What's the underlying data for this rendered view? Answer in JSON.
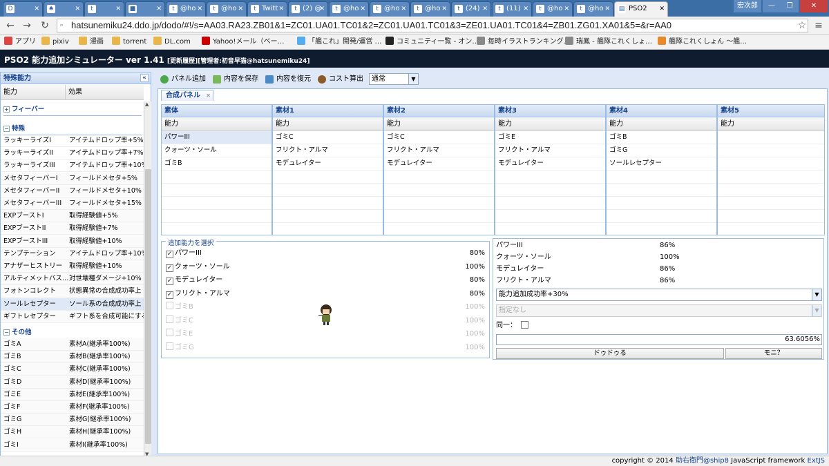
{
  "browser": {
    "tabs": [
      {
        "icon": "D",
        "label": ""
      },
      {
        "icon": "♠",
        "label": ""
      },
      {
        "icon": "t",
        "label": ""
      },
      {
        "icon": "■",
        "label": ""
      },
      {
        "icon": "t",
        "label": "@ho"
      },
      {
        "icon": "t",
        "label": "@ho"
      },
      {
        "icon": "t",
        "label": "Twitt"
      },
      {
        "icon": "t",
        "label": "(2) @"
      },
      {
        "icon": "t",
        "label": "@ho"
      },
      {
        "icon": "t",
        "label": "@ho"
      },
      {
        "icon": "t",
        "label": "@ho"
      },
      {
        "icon": "t",
        "label": "(24)"
      },
      {
        "icon": "t",
        "label": "(11)"
      },
      {
        "icon": "t",
        "label": "@ho"
      },
      {
        "icon": "t",
        "label": "@ho"
      },
      {
        "icon": "▤",
        "label": "PSO2"
      }
    ],
    "user_name": "宏次郎",
    "url": "hatsunemiku24.ddo.jp/dodo/#!/s=AA03.RA23.ZB01&1=ZC01.UA01.TC01&2=ZC01.UA01.TC01&3=ZE01.UA01.TC01&4=ZB01.ZG01.XA01&5=&r=AA0",
    "bookmarks": [
      {
        "label": "アプリ",
        "color": "#d44"
      },
      {
        "label": "pixiv",
        "color": "#e8b64a"
      },
      {
        "label": "漫画",
        "color": "#e8b64a"
      },
      {
        "label": "torrent",
        "color": "#e8b64a"
      },
      {
        "label": "DL.com",
        "color": "#e8b64a"
      },
      {
        "label": "Yahoo!メール（ベー…",
        "color": "#c00"
      },
      {
        "label": "「艦これ」開発/運営 …",
        "color": "#55acee"
      },
      {
        "label": "コミュニティ一覧 - オン…",
        "color": "#222"
      },
      {
        "label": "毎時イラストランキング…",
        "color": "#888"
      },
      {
        "label": "瑞鳳 - 艦隊これくしょ…",
        "color": "#888"
      },
      {
        "label": "艦隊これくしょん 〜艦…",
        "color": "#e88a2a"
      }
    ]
  },
  "app": {
    "title": "PSO2 能力追加シミュレーター ver 1.41",
    "subtitle": "[更新履歴][管理者:初音早猫@hatsunemiku24]"
  },
  "sidebar": {
    "title": "特殊能力",
    "col_ability": "能力",
    "col_effect": "効果",
    "groups": {
      "fever": "フィーバー",
      "special": "特殊",
      "other": "その他"
    },
    "special_items": [
      {
        "name": "ラッキーライズI",
        "effect": "アイテムドロップ率+5%"
      },
      {
        "name": "ラッキーライズII",
        "effect": "アイテムドロップ率+7%"
      },
      {
        "name": "ラッキーライズIII",
        "effect": "アイテムドロップ率+10%"
      },
      {
        "name": "メセタフィーバーI",
        "effect": "フィールドメセタ+5%"
      },
      {
        "name": "メセタフィーバーII",
        "effect": "フィールドメセタ+10%"
      },
      {
        "name": "メセタフィーバーIII",
        "effect": "フィールドメセタ+15%"
      },
      {
        "name": "EXPブーストI",
        "effect": "取得経験値+5%"
      },
      {
        "name": "EXPブーストII",
        "effect": "取得経験値+7%"
      },
      {
        "name": "EXPブーストIII",
        "effect": "取得経験値+10%"
      },
      {
        "name": "テンプテーション",
        "effect": "アイテムドロップ率+10%"
      },
      {
        "name": "アナザーヒストリー",
        "effect": "取得経験値+10%"
      },
      {
        "name": "アルティメットバス…",
        "effect": "対世壊種ダメージ+10%"
      },
      {
        "name": "フォトンコレクト",
        "effect": "状態異常の合成成功率上"
      },
      {
        "name": "ソールレセプター",
        "effect": "ソール系の合成成功率上"
      },
      {
        "name": "ギフトレセプター",
        "effect": "ギフト系を合成可能にする"
      }
    ],
    "other_items": [
      {
        "name": "ゴミA",
        "effect": "素材A(継承率100%)"
      },
      {
        "name": "ゴミB",
        "effect": "素材B(継承率100%)"
      },
      {
        "name": "ゴミC",
        "effect": "素材C(継承率100%)"
      },
      {
        "name": "ゴミD",
        "effect": "素材D(継承率100%)"
      },
      {
        "name": "ゴミE",
        "effect": "素材E(継承率100%)"
      },
      {
        "name": "ゴミF",
        "effect": "素材F(継承率100%)"
      },
      {
        "name": "ゴミG",
        "effect": "素材G(継承率100%)"
      },
      {
        "name": "ゴミH",
        "effect": "素材H(継承率100%)"
      },
      {
        "name": "ゴミI",
        "effect": "素材I(継承率100%)"
      }
    ]
  },
  "toolbar": {
    "add_panel": "パネル追加",
    "save": "内容を保存",
    "restore": "内容を復元",
    "cost": "コスト算出",
    "mode": "通常"
  },
  "panel": {
    "tab_label": "合成パネル",
    "ability_header": "能力",
    "columns": [
      {
        "title": "素体",
        "rows": [
          "パワーIII",
          "クォーツ・ソール",
          "ゴミB"
        ]
      },
      {
        "title": "素材1",
        "rows": [
          "ゴミC",
          "フリクト・アルマ",
          "モデュレイター"
        ]
      },
      {
        "title": "素材2",
        "rows": [
          "ゴミC",
          "フリクト・アルマ",
          "モデュレイター"
        ]
      },
      {
        "title": "素材3",
        "rows": [
          "ゴミE",
          "フリクト・アルマ",
          "モデュレイター"
        ]
      },
      {
        "title": "素材4",
        "rows": [
          "ゴミB",
          "ゴミG",
          "ソールレセプター"
        ]
      },
      {
        "title": "素材5",
        "rows": []
      }
    ],
    "select_legend": "追加能力を選択",
    "choices": [
      {
        "label": "パワーIII",
        "pct": "80%",
        "checked": true,
        "disabled": false
      },
      {
        "label": "クォーツ・ソール",
        "pct": "100%",
        "checked": true,
        "disabled": false
      },
      {
        "label": "モデュレイター",
        "pct": "80%",
        "checked": true,
        "disabled": false
      },
      {
        "label": "フリクト・アルマ",
        "pct": "80%",
        "checked": true,
        "disabled": false
      },
      {
        "label": "ゴミB",
        "pct": "100%",
        "checked": false,
        "disabled": true
      },
      {
        "label": "ゴミC",
        "pct": "100%",
        "checked": false,
        "disabled": true
      },
      {
        "label": "ゴミE",
        "pct": "100%",
        "checked": false,
        "disabled": true
      },
      {
        "label": "ゴミG",
        "pct": "100%",
        "checked": false,
        "disabled": true
      }
    ],
    "results": [
      {
        "name": "パワーIII",
        "rate": "86%"
      },
      {
        "name": "クォーツ・ソール",
        "rate": "100%"
      },
      {
        "name": "モデュレイター",
        "rate": "86%"
      },
      {
        "name": "フリクト・アルマ",
        "rate": "86%"
      }
    ],
    "boost_select": "能力追加成功率+30%",
    "second_select": "指定なし",
    "same_label": "同一：",
    "total_rate": "63.6056%",
    "btn_left": "ドゥドゥる",
    "btn_right": "モニ？"
  },
  "footer": {
    "prefix": "copyright © 2014",
    "author": "助右衛門",
    "ship": "@ship8",
    "framework_text": "JavaScript framework",
    "framework": "ExtJS"
  }
}
